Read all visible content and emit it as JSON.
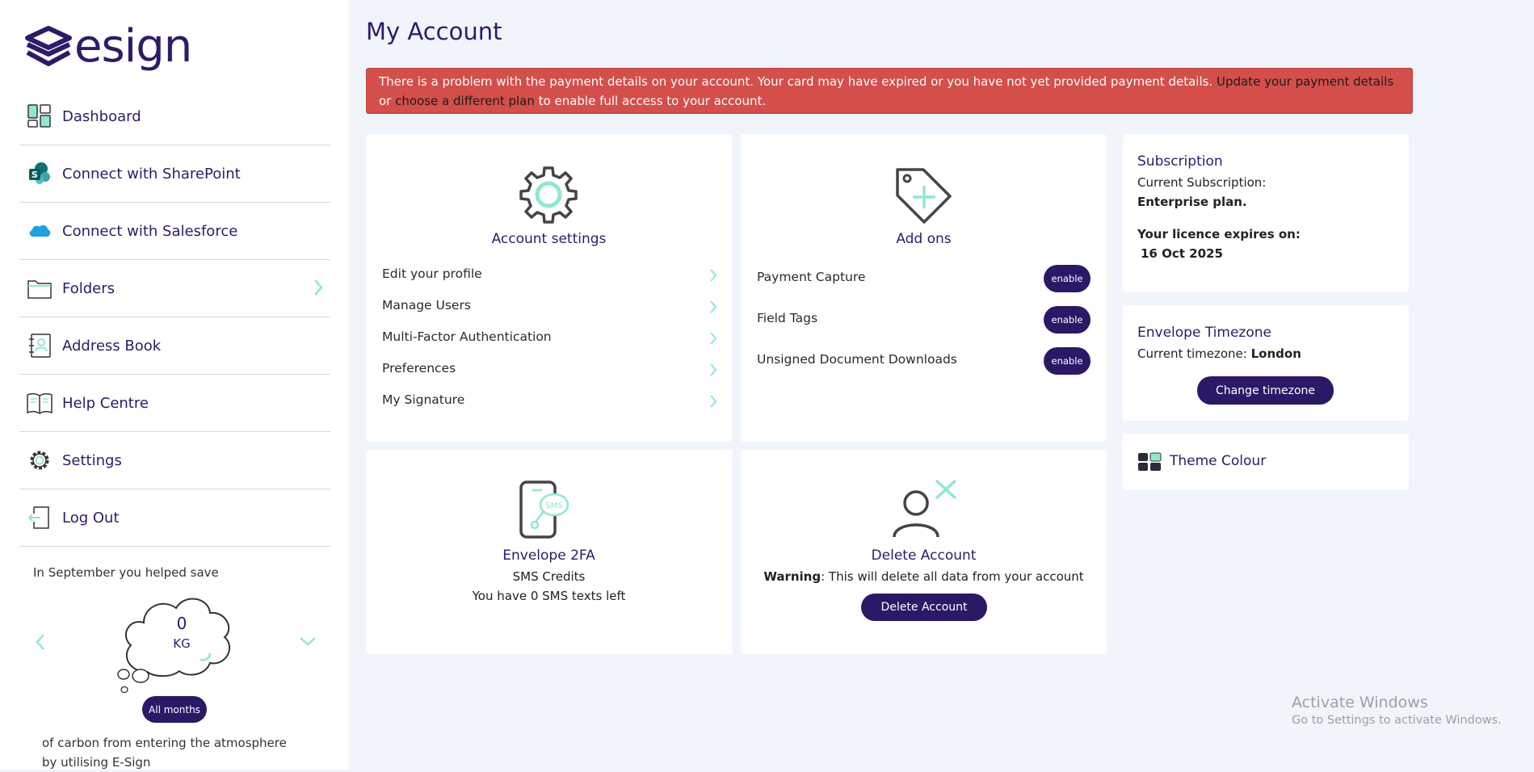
{
  "app": {
    "logo_text": "esign"
  },
  "sidebar": {
    "items": [
      {
        "label": "Dashboard"
      },
      {
        "label": "Connect with SharePoint"
      },
      {
        "label": "Connect with Salesforce"
      },
      {
        "label": "Folders"
      },
      {
        "label": "Address Book"
      },
      {
        "label": "Help Centre"
      },
      {
        "label": "Settings"
      },
      {
        "label": "Log Out"
      }
    ],
    "carbon": {
      "intro": "In September you helped save",
      "value": "0",
      "unit": "KG",
      "button_label": "All months",
      "outro": "of carbon from entering the atmosphere by utilising E-Sign"
    }
  },
  "main": {
    "title": "My Account",
    "alert": {
      "text_1": "There is a problem with the payment details on your account. Your card may have expired or you have not yet provided payment details. ",
      "link_1": "Update your payment details",
      "text_2": " or ",
      "link_2": "choose a different plan",
      "text_3": " to enable full access to your account."
    },
    "account_settings": {
      "title": "Account settings",
      "items": [
        {
          "label": "Edit your profile"
        },
        {
          "label": "Manage Users"
        },
        {
          "label": "Multi-Factor Authentication"
        },
        {
          "label": "Preferences"
        },
        {
          "label": "My Signature"
        }
      ]
    },
    "addons": {
      "title": "Add ons",
      "button_label": "enable",
      "items": [
        {
          "label": "Payment Capture"
        },
        {
          "label": "Field Tags"
        },
        {
          "label": "Unsigned Document Downloads"
        }
      ]
    },
    "subscription": {
      "title": "Subscription",
      "current_label": "Current Subscription:",
      "plan": "Enterprise plan.",
      "expires_label": "Your licence expires on:",
      "expires_date": "16 Oct 2025"
    },
    "timezone": {
      "title": "Envelope Timezone",
      "current_label": "Current timezone:",
      "current_value": "London",
      "button_label": "Change timezone"
    },
    "theme": {
      "title": "Theme Colour"
    },
    "envelope_2fa": {
      "title": "Envelope 2FA",
      "line_1": "SMS Credits",
      "line_2": "You have 0 SMS texts left",
      "sms_label": "SMS"
    },
    "delete_account": {
      "title": "Delete Account",
      "warning_label": "Warning",
      "warning_text": ": This will delete all data from your account",
      "button_label": "Delete Account"
    }
  },
  "watermark": {
    "title": "Activate Windows",
    "subtitle": "Go to Settings to activate Windows."
  },
  "colors": {
    "brand": "#2e1a6b",
    "accent": "#8ee8cf",
    "alert": "#d44e4a",
    "button": "#2b1867"
  }
}
